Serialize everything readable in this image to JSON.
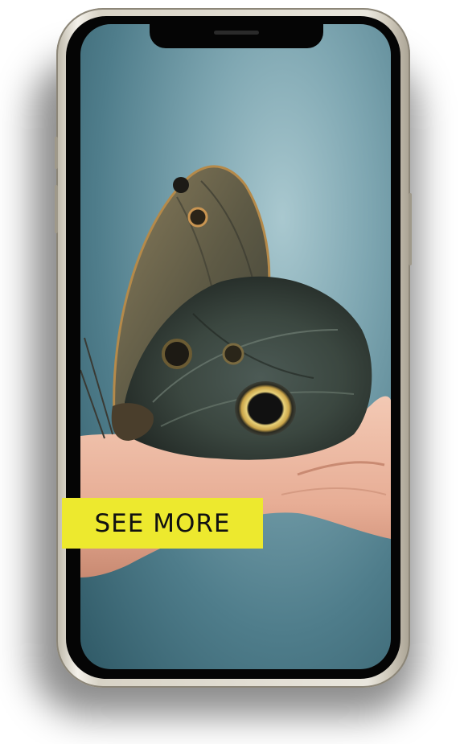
{
  "cta": {
    "label": "SEE MORE",
    "background_color": "#ede92e",
    "text_color": "#111111"
  },
  "photo": {
    "subject_icon": "butterfly-on-hand-image"
  },
  "device": {
    "type": "smartphone",
    "frame_color": "#e9e6dd",
    "bezel_color": "#050505"
  }
}
